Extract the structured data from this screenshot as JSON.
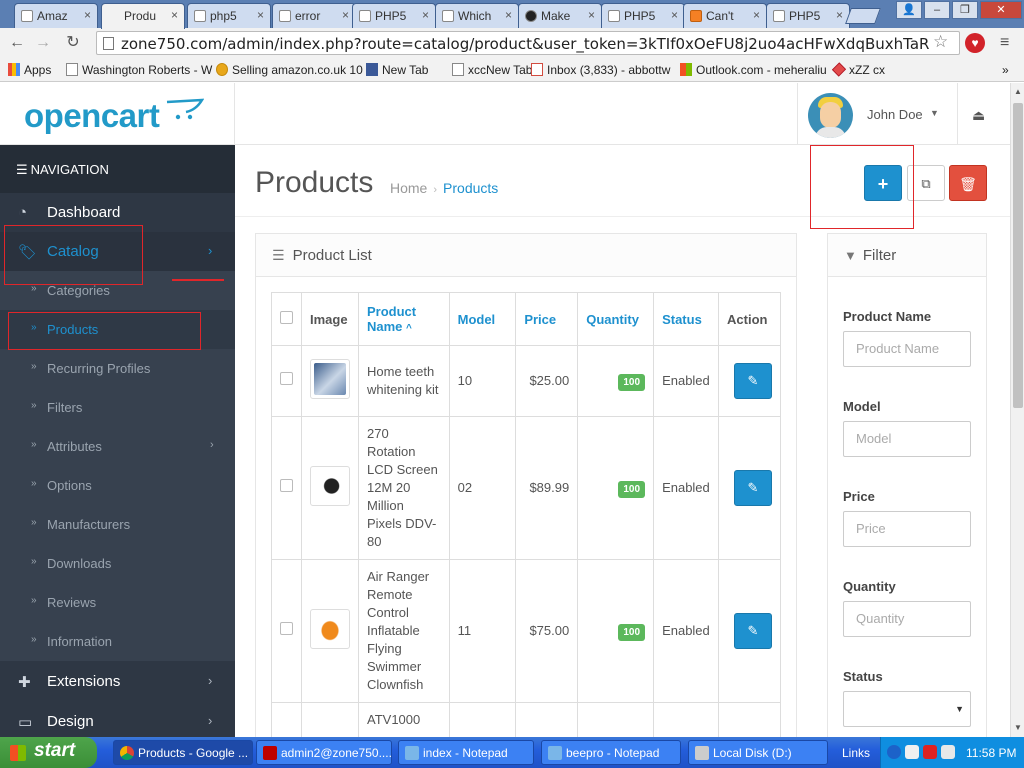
{
  "browser": {
    "tabs": [
      {
        "title": "Amaz",
        "active": false
      },
      {
        "title": "Produ",
        "active": true
      },
      {
        "title": "php5",
        "active": false
      },
      {
        "title": "error",
        "active": false
      },
      {
        "title": "PHP5",
        "active": false
      },
      {
        "title": "Which",
        "active": false
      },
      {
        "title": "Make",
        "active": false
      },
      {
        "title": "PHP5",
        "active": false
      },
      {
        "title": "Can't",
        "active": false
      },
      {
        "title": "PHP5",
        "active": false
      }
    ],
    "url": "zone750.com/admin/index.php?route=catalog/product&user_token=3kTIf0xOeFU8j2uo4acHFwXdqBuxhTaR",
    "bookmarks": [
      {
        "label": "Apps",
        "icon": "apps-icon"
      },
      {
        "label": "Washington Roberts - W",
        "icon": "page-icon"
      },
      {
        "label": "Selling amazon.co.uk 10",
        "icon": "coin-icon"
      },
      {
        "label": "New Tab",
        "icon": "facebook-icon"
      },
      {
        "label": "xccNew Tab",
        "icon": "page-icon"
      },
      {
        "label": "Inbox (3,833) - abbottw",
        "icon": "gmail-icon"
      },
      {
        "label": "Outlook.com - meheraliu",
        "icon": "microsoft-icon"
      },
      {
        "label": "xZZ cx",
        "icon": "diamond-icon"
      }
    ]
  },
  "header": {
    "logo_text": "opencart",
    "user_name": "John Doe"
  },
  "sidebar": {
    "title": "NAVIGATION",
    "items": [
      {
        "label": "Dashboard",
        "icon": "dashboard-icon"
      },
      {
        "label": "Catalog",
        "icon": "tags-icon"
      },
      {
        "label": "Extensions",
        "icon": "puzzle-icon"
      },
      {
        "label": "Design",
        "icon": "monitor-icon"
      }
    ],
    "catalog_sub": [
      {
        "label": "Categories"
      },
      {
        "label": "Products"
      },
      {
        "label": "Recurring Profiles"
      },
      {
        "label": "Filters"
      },
      {
        "label": "Attributes"
      },
      {
        "label": "Options"
      },
      {
        "label": "Manufacturers"
      },
      {
        "label": "Downloads"
      },
      {
        "label": "Reviews"
      },
      {
        "label": "Information"
      }
    ]
  },
  "page": {
    "title": "Products",
    "breadcrumb": [
      "Home",
      "Products"
    ],
    "panel_title": "Product List"
  },
  "table": {
    "columns": [
      "Image",
      "Product Name",
      "Model",
      "Price",
      "Quantity",
      "Status",
      "Action"
    ],
    "rows": [
      {
        "name": "Home teeth whitening kit",
        "model": "10",
        "price": "$25.00",
        "quantity": "100",
        "status": "Enabled"
      },
      {
        "name": "270 Rotation LCD Screen 12M 20 Million Pixels DDV-80",
        "model": "02",
        "price": "$89.99",
        "quantity": "100",
        "status": "Enabled"
      },
      {
        "name": "Air Ranger Remote Control Inflatable Flying Swimmer Clownfish",
        "model": "11",
        "price": "$75.00",
        "quantity": "100",
        "status": "Enabled"
      },
      {
        "name": "ATV1000",
        "model": "",
        "price": "",
        "quantity": "",
        "status": ""
      }
    ]
  },
  "filter": {
    "title": "Filter",
    "fields": [
      {
        "label": "Product Name",
        "placeholder": "Product Name"
      },
      {
        "label": "Model",
        "placeholder": "Model"
      },
      {
        "label": "Price",
        "placeholder": "Price"
      },
      {
        "label": "Quantity",
        "placeholder": "Quantity"
      },
      {
        "label": "Status",
        "placeholder": ""
      }
    ]
  },
  "taskbar": {
    "start_label": "start",
    "items": [
      {
        "label": "Products - Google ..."
      },
      {
        "label": "admin2@zone750...."
      },
      {
        "label": "index - Notepad"
      },
      {
        "label": "beepro - Notepad"
      },
      {
        "label": "Local Disk (D:)"
      }
    ],
    "links_label": "Links",
    "clock": "11:58 PM"
  },
  "colors": {
    "accent": "#1e91cf",
    "sidebar_bg": "#2e3744",
    "delete": "#e3503e",
    "badge": "#5cb85c",
    "annotation": "#e0262a"
  }
}
